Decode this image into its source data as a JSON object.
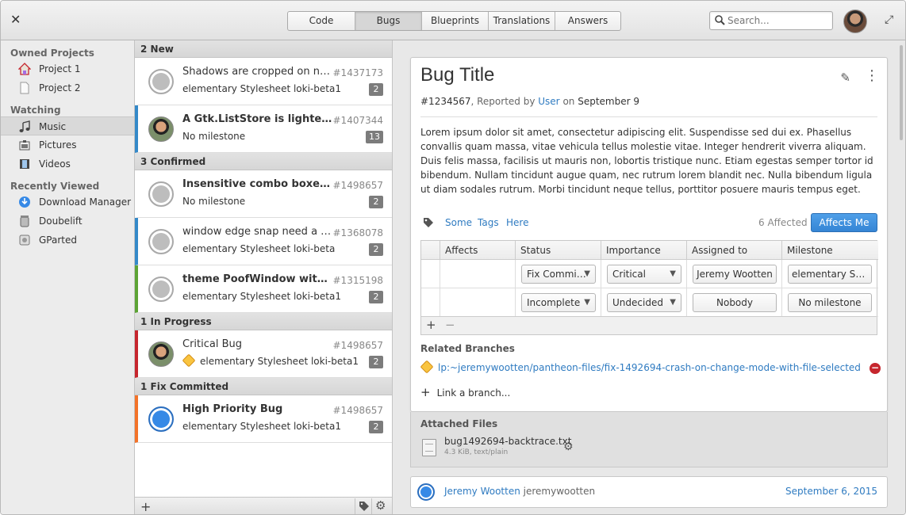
{
  "header": {
    "close_glyph": "✕",
    "tabs": [
      {
        "label": "Code",
        "active": false
      },
      {
        "label": "Bugs",
        "active": true
      },
      {
        "label": "Blueprints",
        "active": false
      },
      {
        "label": "Translations",
        "active": false
      },
      {
        "label": "Answers",
        "active": false
      }
    ],
    "search_placeholder": "Search..."
  },
  "sidebar": {
    "owned_heading": "Owned Projects",
    "owned": [
      {
        "label": "Project 1",
        "icon": "home-icon"
      },
      {
        "label": "Project 2",
        "icon": "document-icon"
      }
    ],
    "watching_heading": "Watching",
    "watching": [
      {
        "label": "Music",
        "icon": "music-icon",
        "selected": true
      },
      {
        "label": "Pictures",
        "icon": "pictures-icon"
      },
      {
        "label": "Videos",
        "icon": "videos-icon"
      }
    ],
    "recent_heading": "Recently Viewed",
    "recent": [
      {
        "label": "Download Manager",
        "icon": "download-icon"
      },
      {
        "label": "Doubelift",
        "icon": "trash-icon"
      },
      {
        "label": "GParted",
        "icon": "disk-icon"
      }
    ]
  },
  "buglist": {
    "groups": [
      {
        "label": "2 New"
      },
      {
        "label": "3 Confirmed"
      },
      {
        "label": "1 In Progress"
      },
      {
        "label": "1 Fix Committed"
      }
    ],
    "bugs": [
      {
        "title": "Shadows are cropped on non-com…",
        "id": "#1437173",
        "sub": "elementary Stylesheet loki-beta1",
        "count": "2",
        "bold": false
      },
      {
        "title": "A Gtk.ListStore is lighter than a …",
        "id": "#1407344",
        "sub": "No milestone",
        "count": "13",
        "bold": true
      },
      {
        "title": "Insensitive combo boxes are …",
        "id": "#1498657",
        "sub": "No milestone",
        "count": "2",
        "bold": true
      },
      {
        "title": "window edge snap need a secon…",
        "id": "#1368078",
        "sub": "elementary Stylesheet loki-beta",
        "count": "2",
        "bold": false
      },
      {
        "title": "theme PoofWindow with CSS",
        "id": "#1315198",
        "sub": "elementary Stylesheet loki-beta1",
        "count": "2",
        "bold": true
      },
      {
        "title": "Critical Bug",
        "id": "#1498657",
        "sub": "elementary Stylesheet loki-beta1",
        "count": "2",
        "bold": false
      },
      {
        "title": "High Priority Bug",
        "id": "#1498657",
        "sub": "elementary Stylesheet loki-beta1",
        "count": "2",
        "bold": true
      }
    ]
  },
  "detail": {
    "title": "Bug Title",
    "meta_id": "#1234567",
    "meta_reported": ", Reported by ",
    "meta_user": "User",
    "meta_on": " on ",
    "meta_date": "September 9",
    "description": "Lorem ipsum dolor sit amet, consectetur adipiscing elit. Suspendisse sed dui ex. Phasellus convallis quam massa, vitae vehicula tellus molestie vitae. Integer hendrerit viverra aliquam. Duis felis massa, facilisis ut mauris non, lobortis tristique nunc. Etiam egestas semper tortor id bibendum. Nullam tincidunt augue quam, nec rutrum lorem blandit nec. Nulla bibendum ligula ut diam sodales rutrum. Morbi tincidunt neque tellus, porttitor posuere mauris tempus eget.",
    "tags": [
      "Some",
      "Tags",
      "Here"
    ],
    "affected": "6 Affected",
    "affects_me": "Affects Me",
    "table": {
      "headers": [
        "Affects",
        "Status",
        "Importance",
        "Assigned to",
        "Milestone"
      ],
      "rows": [
        {
          "status": "Fix Commi…",
          "importance": "Critical",
          "assigned": "Jeremy Wootten",
          "milestone": "elementary Styl…"
        },
        {
          "status": "Incomplete",
          "importance": "Undecided",
          "assigned": "Nobody",
          "milestone": "No milestone"
        }
      ]
    },
    "related_heading": "Related Branches",
    "branch": "lp:~jeremywootten/pantheon-files/fix-1492694-crash-on-change-mode-with-file-selected",
    "link_branch": "Link a branch...",
    "files_heading": "Attached Files",
    "file_name": "bug1492694-backtrace.txt",
    "file_info": "4.3 KiB, text/plain",
    "comment_name": "Jeremy Wootten",
    "comment_user": "jeremywootten",
    "comment_date": "September 6, 2015"
  },
  "colors": {
    "accent": "#3585d5",
    "link": "#2f7bc1",
    "confirmed": "#3489c8",
    "green": "#5ca334",
    "critical": "#c6262e",
    "high": "#f37329"
  }
}
